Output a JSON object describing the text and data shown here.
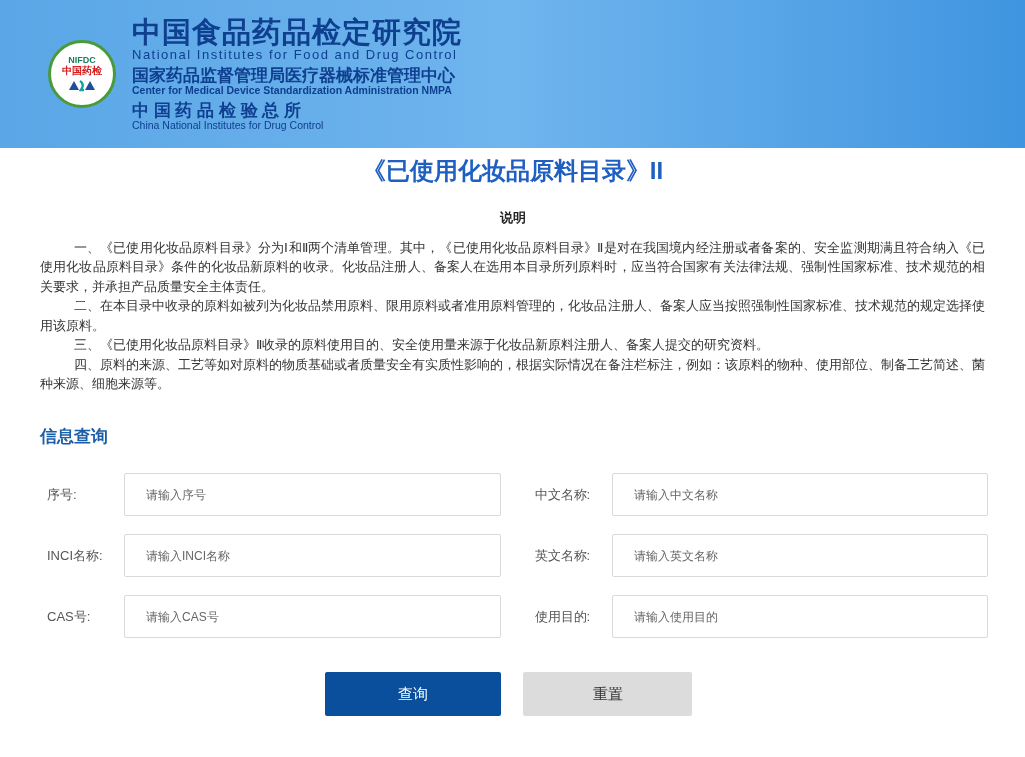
{
  "header": {
    "logo_ring_text": "NIFDC",
    "logo_center_text": "中国药检",
    "title_cn": "中国食品药品检定研究院",
    "title_en": "National Institutes for Food and Drug Control",
    "subtitle_cn": "国家药品监督管理局医疗器械标准管理中心",
    "subtitle_en": "Center for Medical Device Standardization Administration NMPA",
    "third_cn": "中 国 药 品 检 验 总 所",
    "third_en": "China National Institutes for Drug Control"
  },
  "page_title": "《已使用化妆品原料目录》II",
  "notes": {
    "heading": "说明",
    "paragraphs": [
      "一、《已使用化妆品原料目录》分为Ⅰ和Ⅱ两个清单管理。其中，《已使用化妆品原料目录》Ⅱ是对在我国境内经注册或者备案的、安全监测期满且符合纳入《已使用化妆品原料目录》条件的化妆品新原料的收录。化妆品注册人、备案人在选用本目录所列原料时，应当符合国家有关法律法规、强制性国家标准、技术规范的相关要求，并承担产品质量安全主体责任。",
      "二、在本目录中收录的原料如被列为化妆品禁用原料、限用原料或者准用原料管理的，化妆品注册人、备案人应当按照强制性国家标准、技术规范的规定选择使用该原料。",
      "三、《已使用化妆品原料目录》Ⅱ收录的原料使用目的、安全使用量来源于化妆品新原料注册人、备案人提交的研究资料。",
      "四、原料的来源、工艺等如对原料的物质基础或者质量安全有实质性影响的，根据实际情况在备注栏标注，例如：该原料的物种、使用部位、制备工艺简述、菌种来源、细胞来源等。"
    ]
  },
  "query": {
    "heading": "信息查询",
    "fields": [
      {
        "label": "序号:",
        "placeholder": "请输入序号"
      },
      {
        "label": "中文名称:",
        "placeholder": "请输入中文名称"
      },
      {
        "label": "INCI名称:",
        "placeholder": "请输入INCI名称"
      },
      {
        "label": "英文名称:",
        "placeholder": "请输入英文名称"
      },
      {
        "label": "CAS号:",
        "placeholder": "请输入CAS号"
      },
      {
        "label": "使用目的:",
        "placeholder": "请输入使用目的"
      }
    ],
    "buttons": [
      {
        "kind": "primary",
        "label": "查询"
      },
      {
        "kind": "secondary",
        "label": "重置"
      }
    ]
  }
}
